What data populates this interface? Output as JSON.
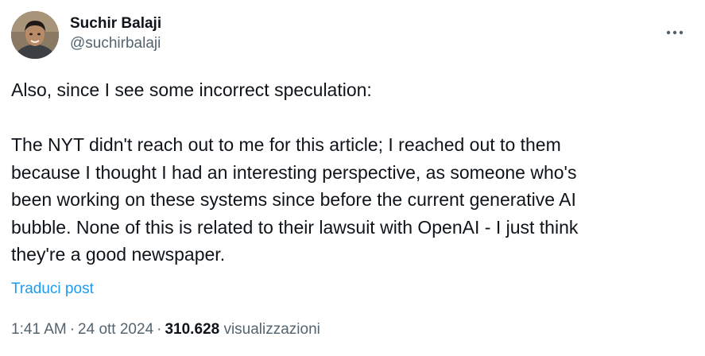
{
  "author": {
    "display_name": "Suchir Balaji",
    "handle": "@suchirbalaji"
  },
  "more_icon": "more-horizontal-icon",
  "post": {
    "text": "Also, since I see some incorrect speculation:\n\nThe NYT didn't reach out to me for this article; I reached out to them\nbecause I thought I had an interesting perspective, as someone who's\nbeen working on these systems since before the current generative AI\nbubble. None of this is related to their lawsuit with OpenAI - I just think\nthey're a good newspaper.",
    "translate_label": "Traduci post"
  },
  "meta": {
    "time": "1:41 AM",
    "separator": "·",
    "date": "24 ott 2024",
    "views_count": "310.628",
    "views_label": "visualizzazioni"
  },
  "colors": {
    "text": "#0f1419",
    "secondary": "#536471",
    "link": "#1d9bf0"
  }
}
